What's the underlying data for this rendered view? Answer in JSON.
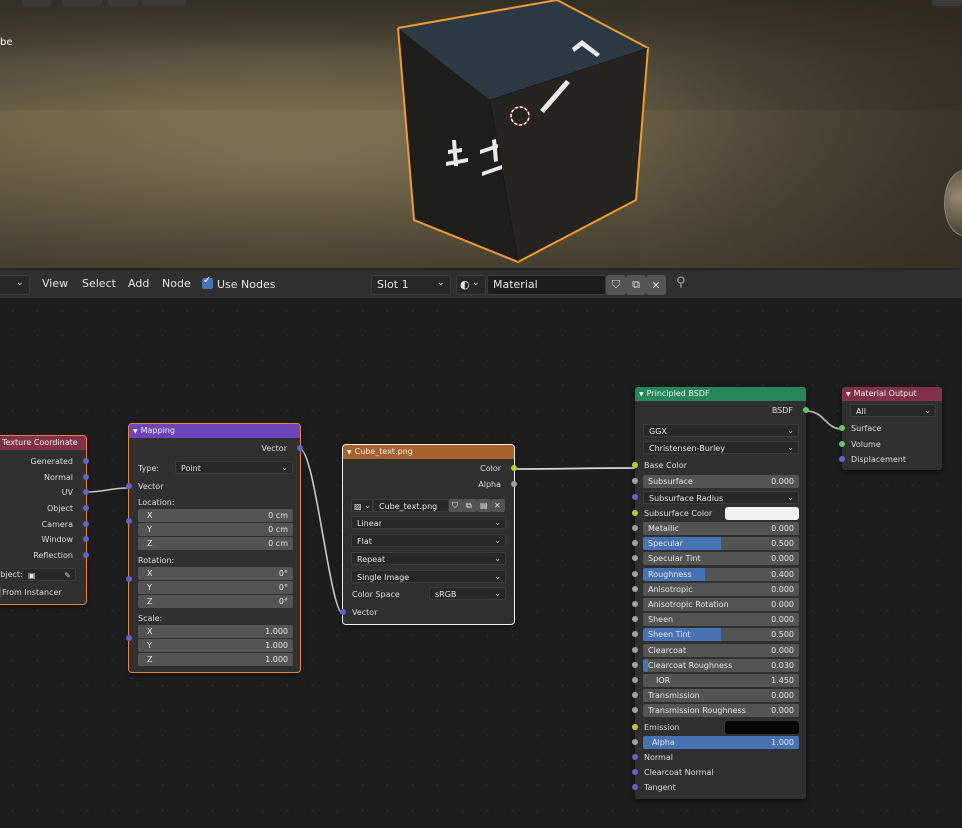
{
  "viewport": {
    "object_label": "be"
  },
  "toolbar": {
    "view": "View",
    "select": "Select",
    "add": "Add",
    "node": "Node",
    "use_nodes": "Use Nodes",
    "slot": "Slot 1",
    "material_name": "Material"
  },
  "texcoord": {
    "title": "Texture Coordinate",
    "outputs": [
      "Generated",
      "Normal",
      "UV",
      "Object",
      "Camera",
      "Window",
      "Reflection"
    ],
    "object_label": "Object:",
    "from_instancer": "From Instancer"
  },
  "mapping": {
    "title": "Mapping",
    "out_vector": "Vector",
    "type_label": "Type:",
    "type_value": "Point",
    "in_vector": "Vector",
    "location_label": "Location:",
    "location": [
      {
        "axis": "X",
        "value": "0 cm"
      },
      {
        "axis": "Y",
        "value": "0 cm"
      },
      {
        "axis": "Z",
        "value": "0 cm"
      }
    ],
    "rotation_label": "Rotation:",
    "rotation": [
      {
        "axis": "X",
        "value": "0°"
      },
      {
        "axis": "Y",
        "value": "0°"
      },
      {
        "axis": "Z",
        "value": "0°"
      }
    ],
    "scale_label": "Scale:",
    "scale": [
      {
        "axis": "X",
        "value": "1.000"
      },
      {
        "axis": "Y",
        "value": "1.000"
      },
      {
        "axis": "Z",
        "value": "1.000"
      }
    ]
  },
  "image": {
    "title": "Cube_text.png",
    "out_color": "Color",
    "out_alpha": "Alpha",
    "image_name": "Cube_text.png",
    "interpolation": "Linear",
    "projection": "Flat",
    "extension": "Repeat",
    "source": "Single Image",
    "color_space_label": "Color Space",
    "color_space": "sRGB",
    "in_vector": "Vector"
  },
  "bsdf": {
    "title": "Principled BSDF",
    "out": "BSDF",
    "distribution": "GGX",
    "subsurface_method": "Christensen-Burley",
    "base_color": "Base Color",
    "subsurface": {
      "label": "Subsurface",
      "value": "0.000"
    },
    "subsurface_radius": "Subsurface Radius",
    "subsurface_color": "Subsurface Color",
    "fields": [
      {
        "label": "Metallic",
        "value": "0.000",
        "fill": 0
      },
      {
        "label": "Specular",
        "value": "0.500",
        "fill": 0.5
      },
      {
        "label": "Specular Tint",
        "value": "0.000",
        "fill": 0
      },
      {
        "label": "Roughness",
        "value": "0.400",
        "fill": 0.4
      },
      {
        "label": "Anisotropic",
        "value": "0.000",
        "fill": 0
      },
      {
        "label": "Anisotropic Rotation",
        "value": "0.000",
        "fill": 0
      },
      {
        "label": "Sheen",
        "value": "0.000",
        "fill": 0
      },
      {
        "label": "Sheen Tint",
        "value": "0.500",
        "fill": 0.5
      },
      {
        "label": "Clearcoat",
        "value": "0.000",
        "fill": 0
      },
      {
        "label": "Clearcoat Roughness",
        "value": "0.030",
        "fill": 0.03
      },
      {
        "label": "IOR",
        "value": "1.450",
        "fill": 0
      },
      {
        "label": "Transmission",
        "value": "0.000",
        "fill": 0
      },
      {
        "label": "Transmission Roughness",
        "value": "0.000",
        "fill": 0
      }
    ],
    "emission": "Emission",
    "alpha": {
      "label": "Alpha",
      "value": "1.000",
      "fill": 1
    },
    "normal": "Normal",
    "clearcoat_normal": "Clearcoat Normal",
    "tangent": "Tangent"
  },
  "output": {
    "title": "Material Output",
    "target": "All",
    "surface": "Surface",
    "volume": "Volume",
    "displacement": "Displacement"
  },
  "colors": {
    "texcoord_header": "#83314a",
    "mapping_header": "#6c45b8",
    "image_header": "#a9612c",
    "bsdf_header": "#26875a",
    "output_header": "#83314a",
    "accent": "#4772b3",
    "selection": "#e5863a"
  }
}
